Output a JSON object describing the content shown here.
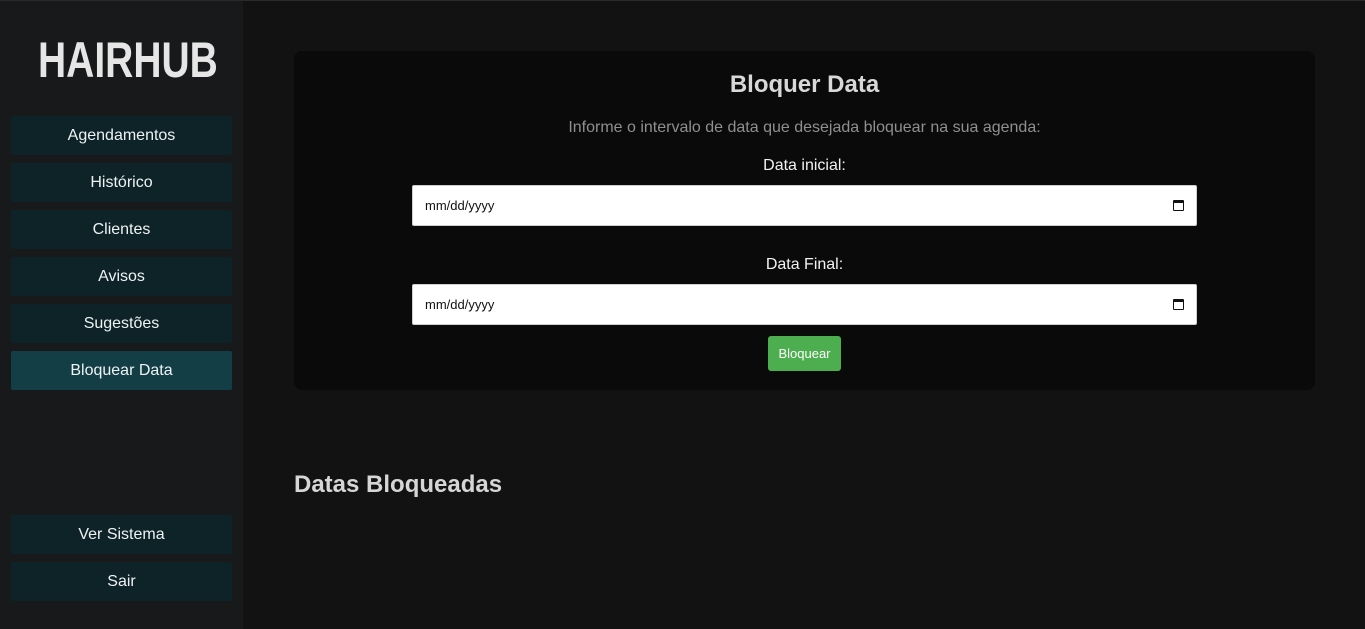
{
  "brand": {
    "name": "HAIRHUB"
  },
  "sidebar": {
    "items": [
      {
        "label": "Agendamentos"
      },
      {
        "label": "Histórico"
      },
      {
        "label": "Clientes"
      },
      {
        "label": "Avisos"
      },
      {
        "label": "Sugestões"
      },
      {
        "label": "Bloquear Data"
      }
    ],
    "bottom_items": [
      {
        "label": "Ver Sistema"
      },
      {
        "label": "Sair"
      }
    ]
  },
  "form": {
    "title": "Bloquer Data",
    "description": "Informe o intervalo de data que desejada bloquear na sua agenda:",
    "start_label": "Data inicial:",
    "start_placeholder": "mm/dd/yyyy",
    "end_label": "Data Final:",
    "end_placeholder": "mm/dd/yyyy",
    "submit_label": "Bloquear"
  },
  "blocked": {
    "title": "Datas Bloqueadas"
  },
  "icons": {
    "logo": "bearded-man-icon",
    "calendar": "calendar-icon"
  },
  "colors": {
    "accent_green": "#4cae4f",
    "nav_bg": "#0d2328",
    "nav_active": "#143e46"
  }
}
